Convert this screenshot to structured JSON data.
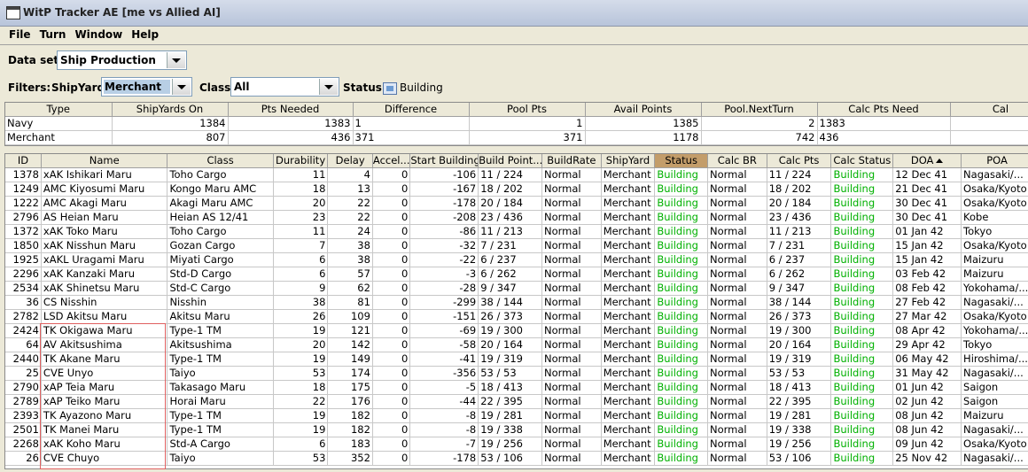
{
  "window": {
    "title": "WitP Tracker AE [me vs Allied AI]"
  },
  "menu": [
    "File",
    "Turn",
    "Window",
    "Help"
  ],
  "dataset": {
    "label": "Data set:",
    "value": "Ship Production"
  },
  "filters": {
    "label": "Filters:",
    "shipyard_label": "ShipYard:",
    "shipyard_value": "Merchant",
    "class_label": "Class:",
    "class_value": "All",
    "status_label": "Status:",
    "status_value": "Building"
  },
  "summary": {
    "headers": [
      "Type",
      "ShipYards On",
      "Pts Needed",
      "Difference",
      "Pool Pts",
      "Avail Points",
      "Pool.NextTurn",
      "Calc Pts Need",
      "Cal"
    ],
    "rows": [
      [
        "Navy",
        "1384",
        "1383",
        "1",
        "1",
        "1385",
        "2",
        "1383",
        ""
      ],
      [
        "Merchant",
        "807",
        "436",
        "371",
        "371",
        "1178",
        "742",
        "436",
        ""
      ]
    ]
  },
  "main": {
    "headers": [
      "ID",
      "Name",
      "Class",
      "Durability",
      "Delay",
      "Accel...",
      "Start Building",
      "Build Point...",
      "BuildRate",
      "ShipYard",
      "Status",
      "Calc BR",
      "Calc Pts",
      "Calc Status",
      "DOA",
      "POA"
    ],
    "rows": [
      [
        "1378",
        "xAK Ishikari Maru",
        "Toho Cargo",
        "11",
        "4",
        "0",
        "-106",
        "11 / 224",
        "Normal",
        "Merchant",
        "Building",
        "Normal",
        "11 / 224",
        "Building",
        "12 Dec 41",
        "Nagasaki/..."
      ],
      [
        "1249",
        "AMC Kiyosumi Maru",
        "Kongo Maru AMC",
        "18",
        "13",
        "0",
        "-167",
        "18 / 202",
        "Normal",
        "Merchant",
        "Building",
        "Normal",
        "18 / 202",
        "Building",
        "21 Dec 41",
        "Osaka/Kyoto"
      ],
      [
        "1222",
        "AMC Akagi Maru",
        "Akagi Maru AMC",
        "20",
        "22",
        "0",
        "-178",
        "20 / 184",
        "Normal",
        "Merchant",
        "Building",
        "Normal",
        "20 / 184",
        "Building",
        "30 Dec 41",
        "Osaka/Kyoto"
      ],
      [
        "2796",
        "AS Heian Maru",
        "Heian AS 12/41",
        "23",
        "22",
        "0",
        "-208",
        "23 / 436",
        "Normal",
        "Merchant",
        "Building",
        "Normal",
        "23 / 436",
        "Building",
        "30 Dec 41",
        "Kobe"
      ],
      [
        "1372",
        "xAK Toko Maru",
        "Toho Cargo",
        "11",
        "24",
        "0",
        "-86",
        "11 / 213",
        "Normal",
        "Merchant",
        "Building",
        "Normal",
        "11 / 213",
        "Building",
        "01 Jan 42",
        "Tokyo"
      ],
      [
        "1850",
        "xAK Nisshun Maru",
        "Gozan Cargo",
        "7",
        "38",
        "0",
        "-32",
        "7 / 231",
        "Normal",
        "Merchant",
        "Building",
        "Normal",
        "7 / 231",
        "Building",
        "15 Jan 42",
        "Osaka/Kyoto"
      ],
      [
        "1925",
        "xAKL Uragami Maru",
        "Miyati Cargo",
        "6",
        "38",
        "0",
        "-22",
        "6 / 237",
        "Normal",
        "Merchant",
        "Building",
        "Normal",
        "6 / 237",
        "Building",
        "15 Jan 42",
        "Maizuru"
      ],
      [
        "2296",
        "xAK Kanzaki Maru",
        "Std-D Cargo",
        "6",
        "57",
        "0",
        "-3",
        "6 / 262",
        "Normal",
        "Merchant",
        "Building",
        "Normal",
        "6 / 262",
        "Building",
        "03 Feb 42",
        "Maizuru"
      ],
      [
        "2534",
        "xAK Shinetsu Maru",
        "Std-C Cargo",
        "9",
        "62",
        "0",
        "-28",
        "9 / 347",
        "Normal",
        "Merchant",
        "Building",
        "Normal",
        "9 / 347",
        "Building",
        "08 Feb 42",
        "Yokohama/..."
      ],
      [
        "36",
        "CS Nisshin",
        "Nisshin",
        "38",
        "81",
        "0",
        "-299",
        "38 / 144",
        "Normal",
        "Merchant",
        "Building",
        "Normal",
        "38 / 144",
        "Building",
        "27 Feb 42",
        "Nagasaki/..."
      ],
      [
        "2782",
        "LSD Akitsu Maru",
        "Akitsu Maru",
        "26",
        "109",
        "0",
        "-151",
        "26 / 373",
        "Normal",
        "Merchant",
        "Building",
        "Normal",
        "26 / 373",
        "Building",
        "27 Mar 42",
        "Osaka/Kyoto"
      ],
      [
        "2424",
        "TK Okigawa Maru",
        "Type-1 TM",
        "19",
        "121",
        "0",
        "-69",
        "19 / 300",
        "Normal",
        "Merchant",
        "Building",
        "Normal",
        "19 / 300",
        "Building",
        "08 Apr 42",
        "Yokohama/..."
      ],
      [
        "64",
        "AV Akitsushima",
        "Akitsushima",
        "20",
        "142",
        "0",
        "-58",
        "20 / 164",
        "Normal",
        "Merchant",
        "Building",
        "Normal",
        "20 / 164",
        "Building",
        "29 Apr 42",
        "Tokyo"
      ],
      [
        "2440",
        "TK Akane Maru",
        "Type-1 TM",
        "19",
        "149",
        "0",
        "-41",
        "19 / 319",
        "Normal",
        "Merchant",
        "Building",
        "Normal",
        "19 / 319",
        "Building",
        "06 May 42",
        "Hiroshima/..."
      ],
      [
        "25",
        "CVE Unyo",
        "Taiyo",
        "53",
        "174",
        "0",
        "-356",
        "53 / 53",
        "Normal",
        "Merchant",
        "Building",
        "Normal",
        "53 / 53",
        "Building",
        "31 May 42",
        "Nagasaki/..."
      ],
      [
        "2790",
        "xAP Teia Maru",
        "Takasago Maru",
        "18",
        "175",
        "0",
        "-5",
        "18 / 413",
        "Normal",
        "Merchant",
        "Building",
        "Normal",
        "18 / 413",
        "Building",
        "01 Jun 42",
        "Saigon"
      ],
      [
        "2789",
        "xAP Teiko Maru",
        "Horai Maru",
        "22",
        "176",
        "0",
        "-44",
        "22 / 395",
        "Normal",
        "Merchant",
        "Building",
        "Normal",
        "22 / 395",
        "Building",
        "02 Jun 42",
        "Saigon"
      ],
      [
        "2393",
        "TK Ayazono Maru",
        "Type-1 TM",
        "19",
        "182",
        "0",
        "-8",
        "19 / 281",
        "Normal",
        "Merchant",
        "Building",
        "Normal",
        "19 / 281",
        "Building",
        "08 Jun 42",
        "Maizuru"
      ],
      [
        "2501",
        "TK Manei Maru",
        "Type-1 TM",
        "19",
        "182",
        "0",
        "-8",
        "19 / 338",
        "Normal",
        "Merchant",
        "Building",
        "Normal",
        "19 / 338",
        "Building",
        "08 Jun 42",
        "Nagasaki/..."
      ],
      [
        "2268",
        "xAK Koho Maru",
        "Std-A Cargo",
        "6",
        "183",
        "0",
        "-7",
        "19 / 256",
        "Normal",
        "Merchant",
        "Building",
        "Normal",
        "19 / 256",
        "Building",
        "09 Jun 42",
        "Osaka/Kyoto"
      ],
      [
        "26",
        "CVE Chuyo",
        "Taiyo",
        "53",
        "352",
        "0",
        "-178",
        "53 / 106",
        "Normal",
        "Merchant",
        "Building",
        "Normal",
        "53 / 106",
        "Building",
        "25 Nov 42",
        "Nagasaki/..."
      ]
    ]
  }
}
